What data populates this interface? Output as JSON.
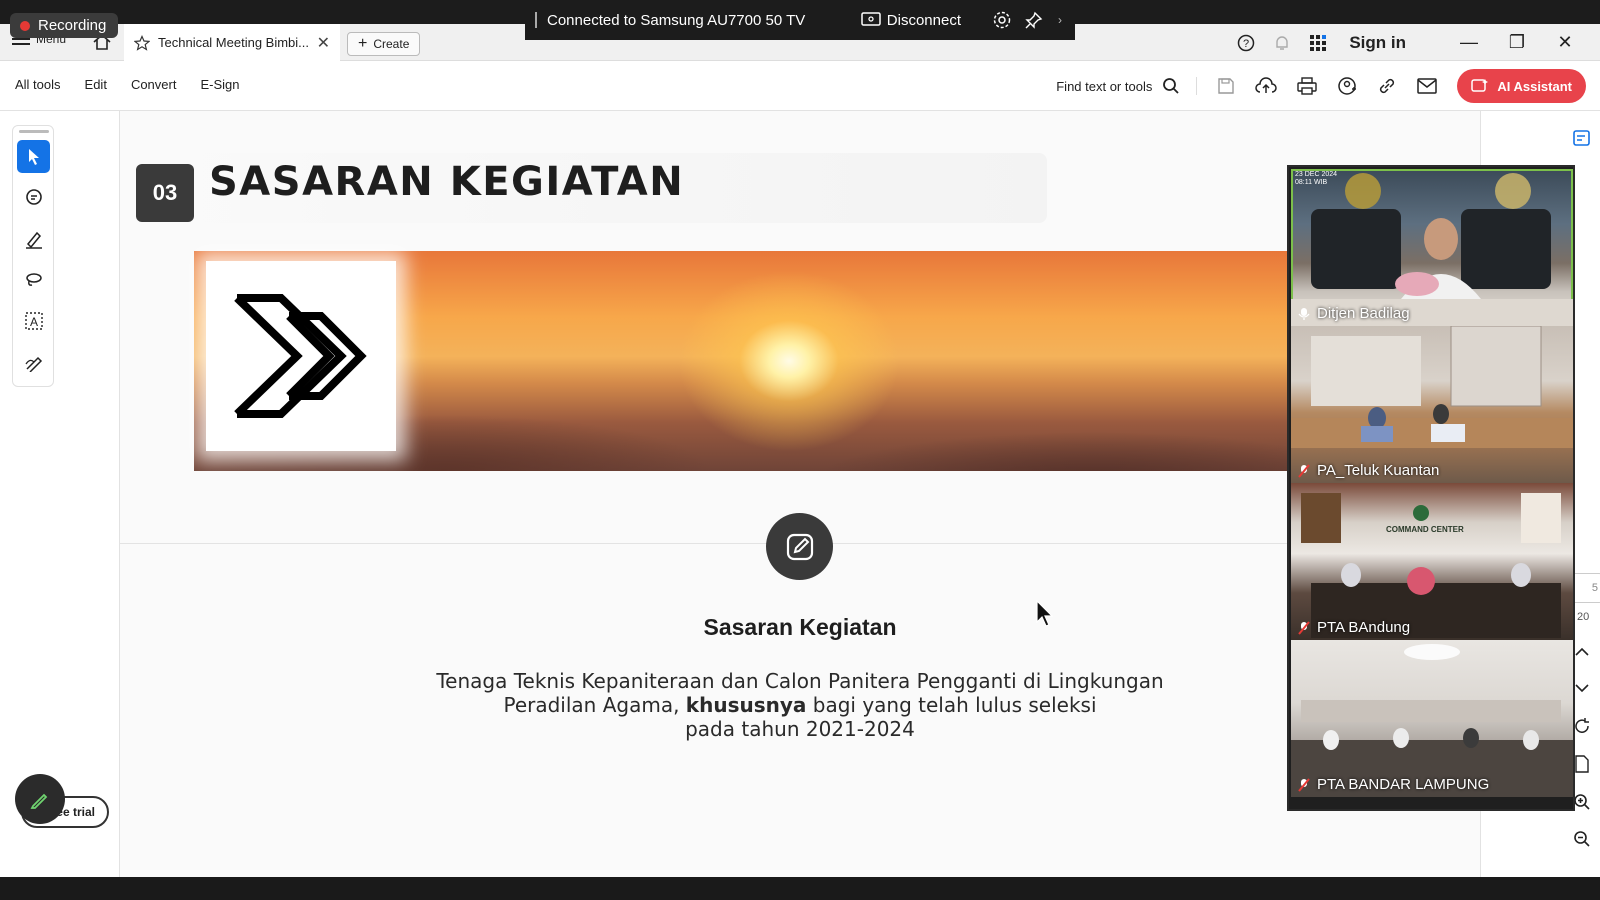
{
  "recording": {
    "label": "Recording"
  },
  "cast": {
    "status": "Connected to Samsung AU7700 50 TV",
    "disconnect": "Disconnect"
  },
  "tabs": {
    "menu_label": "Menu",
    "doc_title": "Technical Meeting Bimbi...",
    "create_label": "Create",
    "sign_in": "Sign in"
  },
  "toolbar": {
    "menu_items": [
      "All tools",
      "Edit",
      "Convert",
      "E-Sign"
    ],
    "find_placeholder": "Find text or tools",
    "ai_label": "AI Assistant"
  },
  "left_panel": {
    "free_trial": "Free trial"
  },
  "slide": {
    "number": "03",
    "title": "SASARAN KEGIATAN",
    "subtitle": "Sasaran Kegiatan",
    "desc_line1": "Tenaga Teknis Kepaniteraan dan Calon Panitera Pengganti di Lingkungan",
    "desc_line2_a": "Peradilan Agama, ",
    "desc_line2_bold": "khususnya",
    "desc_line2_b": " bagi yang telah lulus seleksi",
    "desc_line3": "pada tahun 2021-2024"
  },
  "right_panel": {
    "page_current": "5",
    "page_total": "20"
  },
  "video_tiles": [
    {
      "name": "Ditjen Badilag",
      "stamp": "23 DEC 2024",
      "stamp_time": "08:11 WIB"
    },
    {
      "name": "PA_Teluk Kuantan"
    },
    {
      "name": "PTA BAndung",
      "sign": "COMMAND CENTER"
    },
    {
      "name": "PTA BANDAR LAMPUNG"
    }
  ],
  "colors": {
    "accent_blue": "#1473e6",
    "ai_red": "#e8434b",
    "active_speaker": "#7cc04b"
  }
}
